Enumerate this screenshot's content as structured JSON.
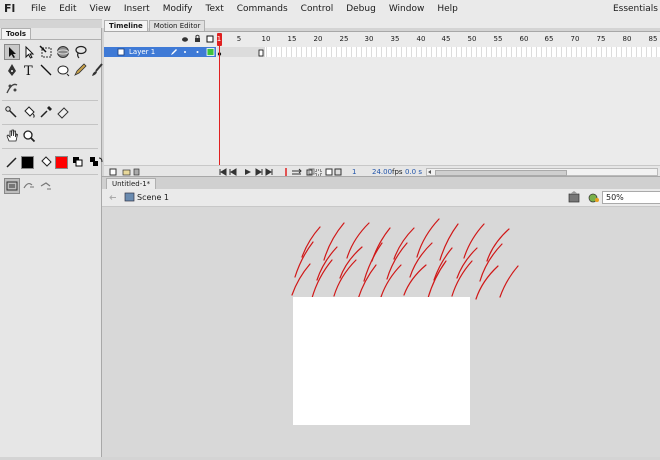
{
  "app": {
    "logo": "Fl",
    "workspace": "Essentials"
  },
  "menu": [
    "File",
    "Edit",
    "View",
    "Insert",
    "Modify",
    "Text",
    "Commands",
    "Control",
    "Debug",
    "Window",
    "Help"
  ],
  "tools": {
    "tab_label": "Tools"
  },
  "timeline": {
    "tabs": [
      {
        "label": "Timeline",
        "active": true
      },
      {
        "label": "Motion Editor",
        "active": false
      }
    ],
    "layer_name": "Layer 1",
    "ruler_labels": [
      "1",
      "5",
      "10",
      "15",
      "20",
      "25",
      "30",
      "35",
      "40",
      "45",
      "50",
      "55",
      "60",
      "65",
      "70",
      "75",
      "80",
      "85"
    ],
    "current_frame": "1",
    "fps": "24.00",
    "fps_unit": "fps",
    "elapsed": "0.0 s"
  },
  "document": {
    "tab_label": "Untitled-1*",
    "scene_label": "Scene 1",
    "zoom": "50%"
  },
  "colors": {
    "stroke": "#000000",
    "fill": "#ff0000",
    "layer_selected": "#3f7ad6",
    "playhead": "#e02020",
    "rain": "#d01818",
    "stage": "#ffffff"
  }
}
